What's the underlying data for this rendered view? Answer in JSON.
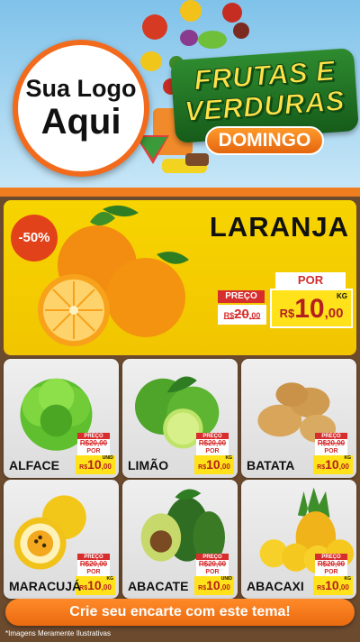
{
  "header": {
    "logo_line1": "Sua Logo",
    "logo_line2": "Aqui",
    "title_line1": "FRUTAS E",
    "title_line2": "VERDURAS",
    "day": "DOMINGO"
  },
  "featured": {
    "discount": "-50%",
    "name": "LARANJA",
    "preco_label": "PREÇO",
    "por_label": "POR",
    "currency": "R$",
    "old_int": "20",
    "old_dec": ",00",
    "new_int": "10",
    "new_dec": ",00",
    "unit": "KG",
    "icon": "orange-icon"
  },
  "products": [
    {
      "name": "ALFACE",
      "icon": "lettuce-icon",
      "preco_label": "PREÇO",
      "old": "R$20,00",
      "por_label": "POR",
      "currency": "R$",
      "new_int": "10",
      "new_dec": ",00",
      "unit": "UNID"
    },
    {
      "name": "LIMÃO",
      "icon": "lime-icon",
      "preco_label": "PREÇO",
      "old": "R$20,00",
      "por_label": "POR",
      "currency": "R$",
      "new_int": "10",
      "new_dec": ",00",
      "unit": "KG"
    },
    {
      "name": "BATATA",
      "icon": "potato-icon",
      "preco_label": "PREÇO",
      "old": "R$20,00",
      "por_label": "POR",
      "currency": "R$",
      "new_int": "10",
      "new_dec": ",00",
      "unit": "KG"
    },
    {
      "name": "MARACUJÁ",
      "icon": "passion-fruit-icon",
      "preco_label": "PREÇO",
      "old": "R$20,00",
      "por_label": "POR",
      "currency": "R$",
      "new_int": "10",
      "new_dec": ",00",
      "unit": "KG"
    },
    {
      "name": "ABACATE",
      "icon": "avocado-icon",
      "preco_label": "PREÇO",
      "old": "R$20,00",
      "por_label": "POR",
      "currency": "R$",
      "new_int": "10",
      "new_dec": ",00",
      "unit": "UNID"
    },
    {
      "name": "ABACAXI",
      "icon": "pineapple-icon",
      "preco_label": "PREÇO",
      "old": "R$20,00",
      "por_label": "POR",
      "currency": "R$",
      "new_int": "10",
      "new_dec": ",00",
      "unit": "KG"
    }
  ],
  "cta": "Crie seu encarte com este tema!",
  "footnote": "*Imagens Meramente Ilustrativas",
  "colors": {
    "accent_orange": "#f07d1e",
    "price_yellow": "#ffe21a",
    "price_red": "#d72d2d",
    "title_green": "#2e8b2f",
    "title_yellow": "#ffe14a"
  }
}
